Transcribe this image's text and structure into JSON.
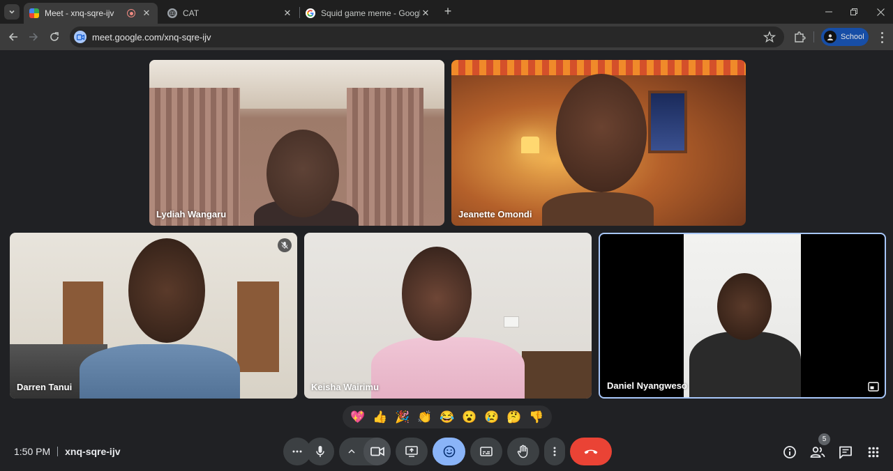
{
  "browser": {
    "tabs": [
      {
        "title": "Meet - xnq-sqre-ijv",
        "favicon": "google-meet-icon",
        "recording": true,
        "active": true
      },
      {
        "title": "CAT",
        "favicon": "globe-icon",
        "active": false
      },
      {
        "title": "Squid game meme - Google Se",
        "favicon": "google-g-icon",
        "active": false
      }
    ],
    "url": "meet.google.com/xnq-sqre-ijv",
    "profile_label": "School"
  },
  "meeting": {
    "code": "xnq-sqre-ijv",
    "time": "1:50 PM",
    "participant_count": "5",
    "participants": [
      {
        "name": "Lydiah Wangaru",
        "muted": false
      },
      {
        "name": "Jeanette Omondi",
        "muted": false
      },
      {
        "name": "Darren Tanui",
        "muted": true
      },
      {
        "name": "Keisha Wairimu",
        "muted": false
      },
      {
        "name": "Daniel Nyangweso",
        "muted": false,
        "highlighted": true
      }
    ],
    "reactions": [
      "💖",
      "👍",
      "🎉",
      "👏",
      "😂",
      "😮",
      "😢",
      "🤔",
      "👎"
    ]
  },
  "colors": {
    "accent_blue": "#8ab4f8",
    "end_call_red": "#ea4335",
    "stage_bg": "#202124",
    "control_bg": "#3c4043"
  }
}
